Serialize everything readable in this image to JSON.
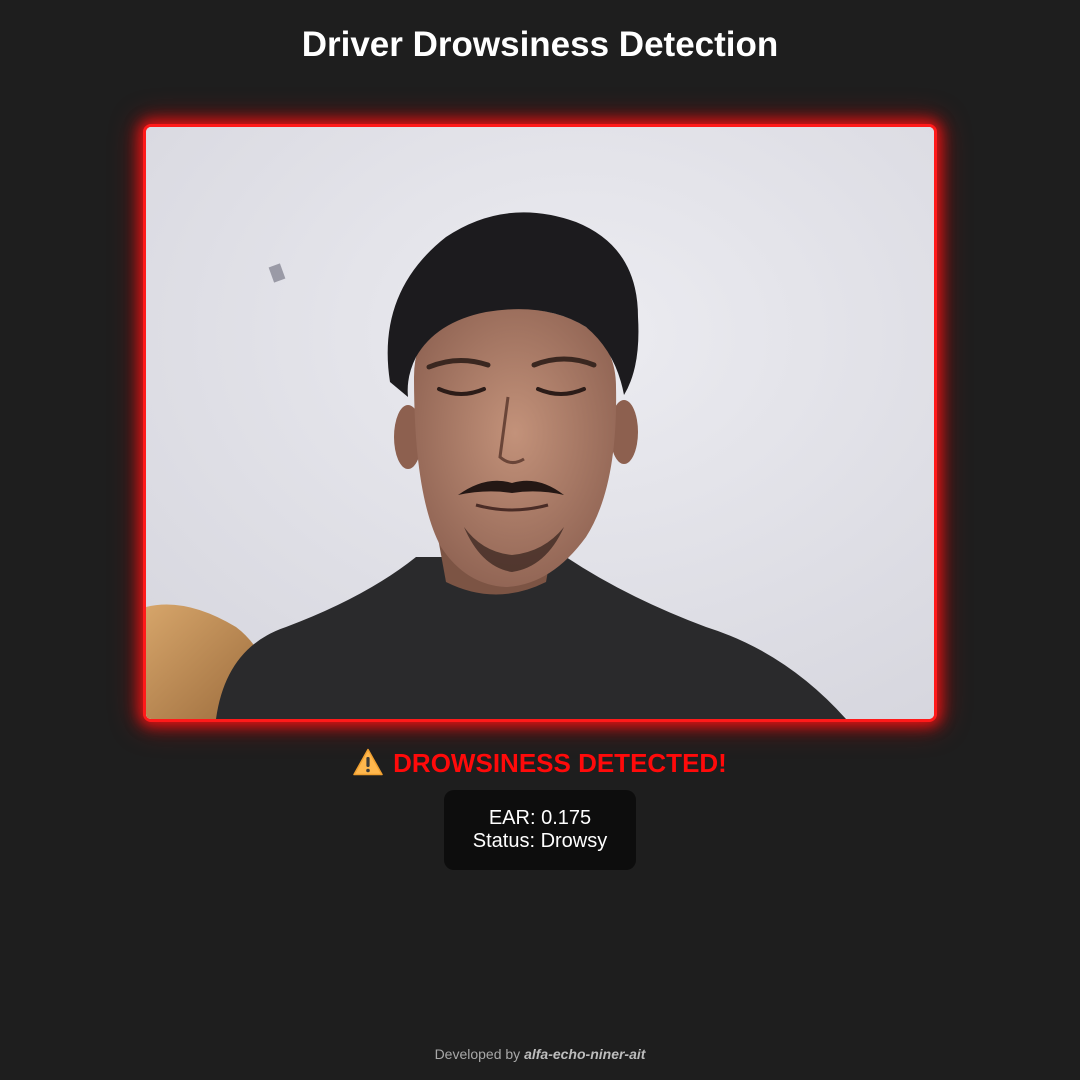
{
  "header": {
    "title": "Driver Drowsiness Detection"
  },
  "video": {
    "border_color": "#ff1a1a",
    "content": "webcam-feed"
  },
  "alert": {
    "icon": "warning-icon",
    "text": "DROWSINESS DETECTED!",
    "color": "#ff0a0a"
  },
  "stats": {
    "ear_text": "EAR: 0.175",
    "status_text": "Status: Drowsy"
  },
  "footer": {
    "prefix": "Developed by",
    "author": "alfa-echo-niner-ait"
  }
}
